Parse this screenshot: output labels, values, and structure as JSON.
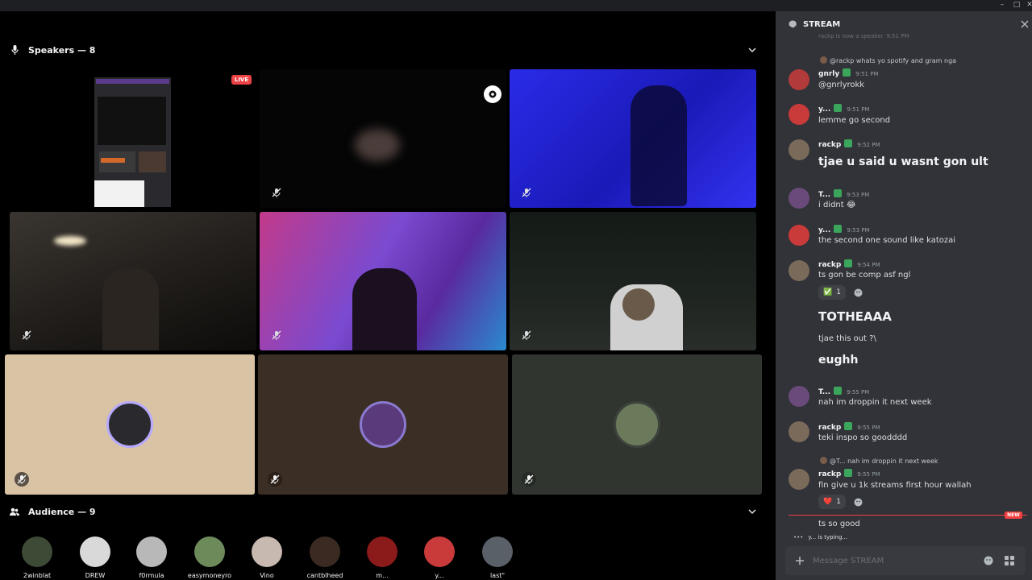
{
  "window": {
    "minimize": "–",
    "maximize": "□",
    "close": "✕"
  },
  "speakers": {
    "label": "Speakers — 8",
    "live_badge": "LIVE"
  },
  "audience": {
    "label": "Audience — 9",
    "members": [
      {
        "name": "2winblat",
        "color": "#3d4a36"
      },
      {
        "name": "DREW",
        "color": "#d9d9d9"
      },
      {
        "name": "f0rmula",
        "color": "#b8b8b8"
      },
      {
        "name": "easymoneyro",
        "color": "#6d8a5a"
      },
      {
        "name": "Vino",
        "color": "#c7b9b0"
      },
      {
        "name": "cantblheed",
        "color": "#3a2a22"
      },
      {
        "name": "m...",
        "color": "#8b1a1a"
      },
      {
        "name": "y...",
        "color": "#c93a3a"
      },
      {
        "name": "last\"",
        "color": "#5a6068"
      }
    ]
  },
  "chat": {
    "channel": "STREAM",
    "top_partial": "rackp is now a speaker. 9:51 PM",
    "messages": [
      {
        "reply_to": "@rackp whats yo spotify and gram nga",
        "user": "gnrly",
        "time": "9:51 PM",
        "text": "@gnrlyrokk",
        "avatar_color": "#b33a3a"
      },
      {
        "user": "y...",
        "time": "9:51 PM",
        "text": "lemme go second",
        "avatar_color": "#c93a3a"
      },
      {
        "user": "rackp",
        "time": "9:52 PM",
        "text": "tjae u said u wasnt gon ult",
        "avatar_color": "#7a6a5a"
      },
      {
        "user": "T...",
        "time": "9:53 PM",
        "text": "i didnt 😂",
        "avatar_color": "#6a4a7a"
      },
      {
        "user": "y...",
        "time": "9:53 PM",
        "text": "the second one sound like katozai",
        "avatar_color": "#c93a3a"
      },
      {
        "user": "rackp",
        "time": "9:54 PM",
        "text": "ts gon be comp asf ngl",
        "avatar_color": "#7a6a5a"
      },
      {
        "reaction_emoji": "✅",
        "reaction_count": "1"
      },
      {
        "text": "TOTHEAAA"
      },
      {
        "text": "tjae this out ?\\"
      },
      {
        "text": "eughh"
      },
      {
        "user": "T...",
        "time": "9:55 PM",
        "text": "nah im droppin it next week",
        "avatar_color": "#6a4a7a"
      },
      {
        "user": "rackp",
        "time": "9:55 PM",
        "text": "teki inspo so goodddd",
        "avatar_color": "#7a6a5a"
      },
      {
        "reply_to": "@T... nah im droppin it next week",
        "user": "rackp",
        "time": "9:55 PM",
        "text": "fin give u 1k streams first hour wallah",
        "avatar_color": "#7a6a5a"
      },
      {
        "reaction_emoji": "❤️",
        "reaction_count": "1"
      },
      {
        "text": "ts so good"
      }
    ],
    "new_badge": "NEW",
    "typing": "y... is typing...",
    "composer_placeholder": "Message STREAM"
  }
}
